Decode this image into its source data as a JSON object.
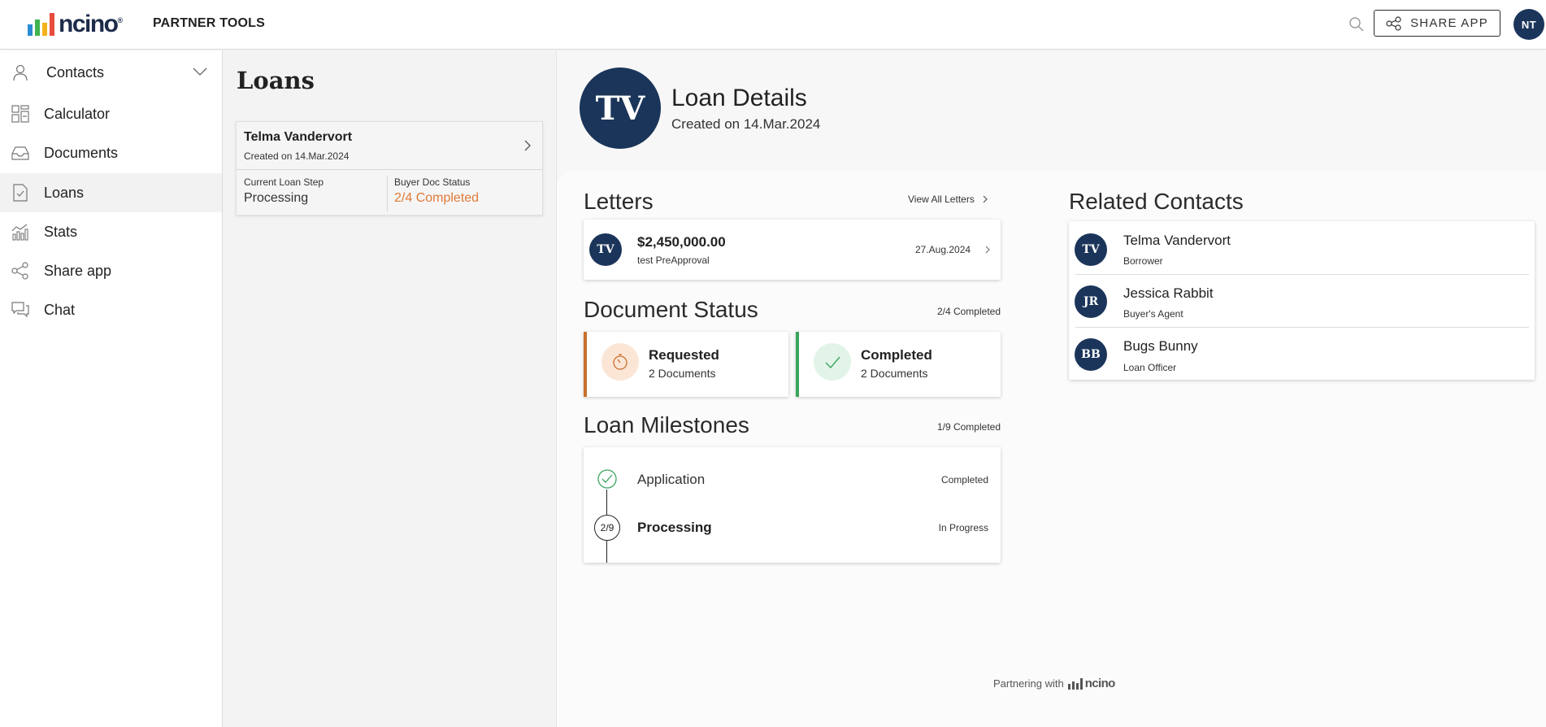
{
  "header": {
    "brand": "ncino",
    "brand_mark": "®",
    "title": "PARTNER TOOLS",
    "share_label": "SHARE APP",
    "user_initials": "NT",
    "brand_colors": [
      "#2a8bd0",
      "#3eb34f",
      "#f3b21b",
      "#e84c3d"
    ]
  },
  "sidebar": {
    "items": [
      {
        "label": "Contacts",
        "icon": "person-icon"
      },
      {
        "label": "Calculator",
        "icon": "calculator-icon"
      },
      {
        "label": "Documents",
        "icon": "inbox-icon"
      },
      {
        "label": "Loans",
        "icon": "document-check-icon"
      },
      {
        "label": "Stats",
        "icon": "stats-icon"
      },
      {
        "label": "Share app",
        "icon": "share-icon"
      },
      {
        "label": "Chat",
        "icon": "chat-icon"
      }
    ],
    "active": "Loans"
  },
  "loans": {
    "title": "Loans",
    "card": {
      "name": "Telma Vandervort",
      "created": "Created on 14.Mar.2024",
      "step_label": "Current Loan Step",
      "step_value": "Processing",
      "doc_label": "Buyer Doc Status",
      "doc_value": "2/4 Completed"
    }
  },
  "detail": {
    "initials": "TV",
    "title": "Loan Details",
    "created": "Created on 14.Mar.2024"
  },
  "letters": {
    "title": "Letters",
    "view_all": "View All Letters",
    "item": {
      "initials": "TV",
      "amount": "$2,450,000.00",
      "name": "test PreApproval",
      "date": "27.Aug.2024"
    }
  },
  "doc_status": {
    "title": "Document Status",
    "summary": "2/4 Completed",
    "requested": {
      "title": "Requested",
      "count": "2 Documents"
    },
    "completed": {
      "title": "Completed",
      "count": "2 Documents"
    }
  },
  "milestones": {
    "title": "Loan Milestones",
    "summary": "1/9 Completed",
    "items": [
      {
        "label": "Application",
        "status": "Completed"
      },
      {
        "label": "Processing",
        "status": "In Progress",
        "step": "2/9"
      }
    ]
  },
  "related": {
    "title": "Related Contacts",
    "contacts": [
      {
        "initials": "TV",
        "name": "Telma Vandervort",
        "role": "Borrower"
      },
      {
        "initials": "JR",
        "name": "Jessica Rabbit",
        "role": "Buyer's Agent"
      },
      {
        "initials": "BB",
        "name": "Bugs Bunny",
        "role": "Loan Officer"
      }
    ]
  },
  "footer": {
    "text": "Partnering with",
    "brand": "ncino"
  }
}
